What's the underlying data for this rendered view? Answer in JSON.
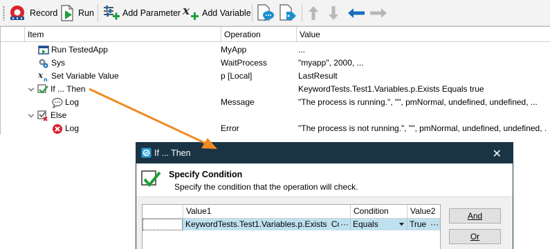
{
  "toolbar": {
    "record_label": "Record",
    "run_label": "Run",
    "add_parameter_label": "Add Parameter",
    "add_variable_label": "Add Variable"
  },
  "grid": {
    "columns": {
      "item": "Item",
      "operation": "Operation",
      "value": "Value"
    },
    "rows": [
      {
        "item": "Run TestedApp",
        "operation": "MyApp",
        "value": "..."
      },
      {
        "item": "Sys",
        "operation": "WaitProcess",
        "value": "\"myapp\", 2000, ..."
      },
      {
        "item": "Set Variable Value",
        "operation": "p [Local]",
        "value": "LastResult"
      },
      {
        "item": "If ... Then",
        "operation": "",
        "value": "KeywordTests.Test1.Variables.p.Exists Equals true"
      },
      {
        "item": "Log",
        "operation": "Message",
        "value": "\"The process is running.\", \"\", pmNormal, undefined, undefined, ..."
      },
      {
        "item": "Else",
        "operation": "",
        "value": ""
      },
      {
        "item": "Log",
        "operation": "Error",
        "value": "\"The process is not running.\", \"\", pmNormal, undefined, undefined, ..."
      }
    ]
  },
  "dialog": {
    "title": "If ... Then",
    "close_glyph": "✕",
    "header_title": "Specify Condition",
    "header_desc": "Specify the condition that the operation will check.",
    "table": {
      "columns": {
        "value1": "Value1",
        "condition": "Condition",
        "value2": "Value2"
      },
      "row": {
        "value1": "KeywordTests.Test1.Variables.p.Exists",
        "value1_mode": "Code",
        "ellipsis": "···",
        "condition": "Equals",
        "value2": "True"
      }
    },
    "and_label": "And",
    "or_label": "Or"
  },
  "colors": {
    "dialog_title_bg": "#1b3445",
    "selection_bg": "#bfe0ef",
    "arrow": "#f08a24",
    "nav_arrow_left": "#1a6cc0",
    "nav_arrow_disabled": "#b8b8b8"
  },
  "icons": [
    "record-icon",
    "run-icon",
    "add-parameter-icon",
    "add-variable-icon",
    "comment-icon",
    "tag-icon",
    "move-up-icon",
    "move-down-icon",
    "move-left-icon",
    "move-right-icon"
  ]
}
